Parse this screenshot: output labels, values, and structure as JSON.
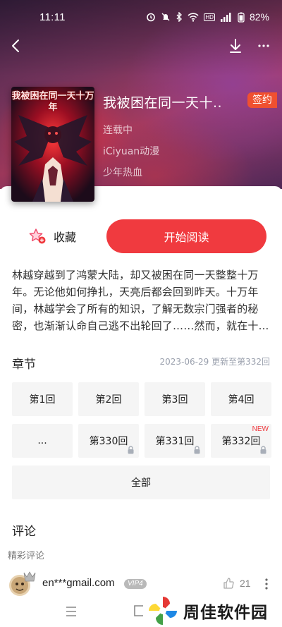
{
  "status_bar": {
    "time": "11:11",
    "network_label": "HD",
    "battery": "82%"
  },
  "icons": {
    "back": "chevron-left-icon",
    "download": "download-icon",
    "more": "more-dots-icon",
    "favorite": "star-add-icon",
    "lock": "lock-icon",
    "like": "thumbs-up-icon"
  },
  "book": {
    "title": "我被困在同一天十..",
    "cover_title": "我被困在同一天十万年",
    "badge": "签约",
    "status": "连载中",
    "publisher": "iCiyuan动漫",
    "genre": "少年热血"
  },
  "actions": {
    "favorite_label": "收藏",
    "read_label": "开始阅读"
  },
  "synopsis": "林越穿越到了鸿蒙大陆，却又被困在同一天整整十万年。无论他如何挣扎，天亮后都会回到昨天。十万年间，林越学会了所有的知识，了解无数宗门强者的秘密，也渐渐认命自己逃不出轮回了……然而，就在十...",
  "chapters": {
    "heading": "章节",
    "update_info": "2023-06-29 更新至第332回",
    "items": [
      {
        "label": "第1回",
        "locked": false,
        "new": ""
      },
      {
        "label": "第2回",
        "locked": false,
        "new": ""
      },
      {
        "label": "第3回",
        "locked": false,
        "new": ""
      },
      {
        "label": "第4回",
        "locked": false,
        "new": ""
      },
      {
        "label": "...",
        "locked": false,
        "new": ""
      },
      {
        "label": "第330回",
        "locked": true,
        "new": ""
      },
      {
        "label": "第331回",
        "locked": true,
        "new": ""
      },
      {
        "label": "第332回",
        "locked": true,
        "new": "NEW"
      }
    ],
    "all_label": "全部"
  },
  "comments": {
    "heading": "评论",
    "subheading": "精彩评论",
    "items": [
      {
        "user": "en***gmail.com",
        "vip": "VIP4",
        "likes": "21"
      }
    ]
  },
  "watermark": {
    "text": "周佳软件园"
  },
  "colors": {
    "accent": "#f03a3f",
    "badge": "#f05030",
    "muted": "#9aa0ad"
  }
}
